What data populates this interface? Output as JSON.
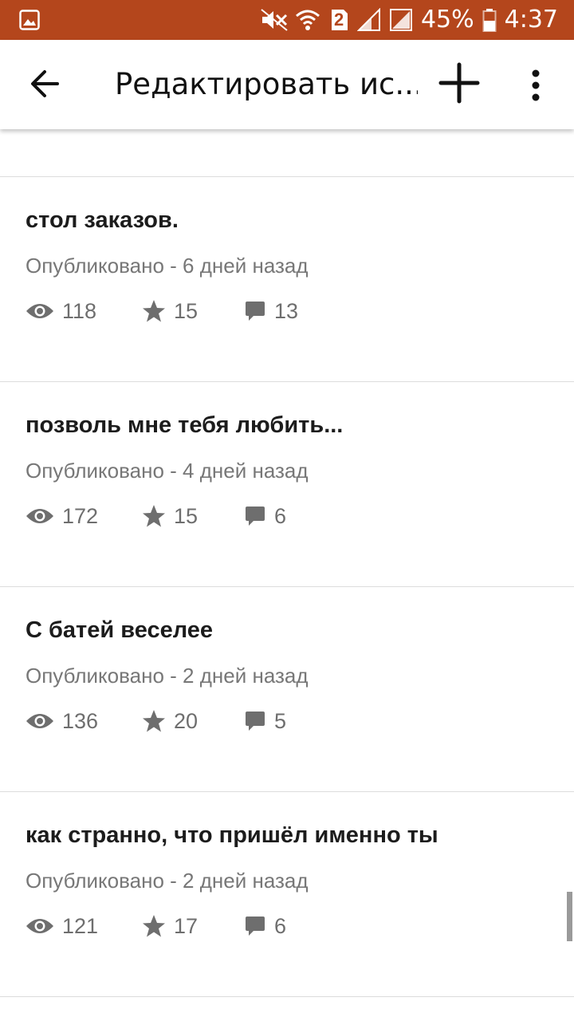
{
  "status_bar": {
    "battery_percent": "45%",
    "time": "4:37",
    "sim_number": "2",
    "icons": [
      "gallery-icon",
      "mute-icon",
      "wifi-icon",
      "sim-icon",
      "signal-icon",
      "signal-off-icon",
      "battery-icon"
    ],
    "background_color": "#b4461c"
  },
  "app_bar": {
    "title": "Редактировать ис...",
    "back_icon": "arrow-left-icon",
    "add_icon": "plus-icon",
    "more_icon": "more-vert-icon"
  },
  "stories": [
    {
      "title": "стол заказов.",
      "published": "Опубликовано - 6 дней назад",
      "views": "118",
      "votes": "15",
      "comments": "13"
    },
    {
      "title": "позволь мне тебя любить...",
      "published": "Опубликовано - 4 дней назад",
      "views": "172",
      "votes": "15",
      "comments": "6"
    },
    {
      "title": "С батей веселее",
      "published": "Опубликовано - 2 дней назад",
      "views": "136",
      "votes": "20",
      "comments": "5"
    },
    {
      "title": "как странно, что пришёл именно ты",
      "published": "Опубликовано - 2 дней назад",
      "views": "121",
      "votes": "17",
      "comments": "6"
    }
  ]
}
